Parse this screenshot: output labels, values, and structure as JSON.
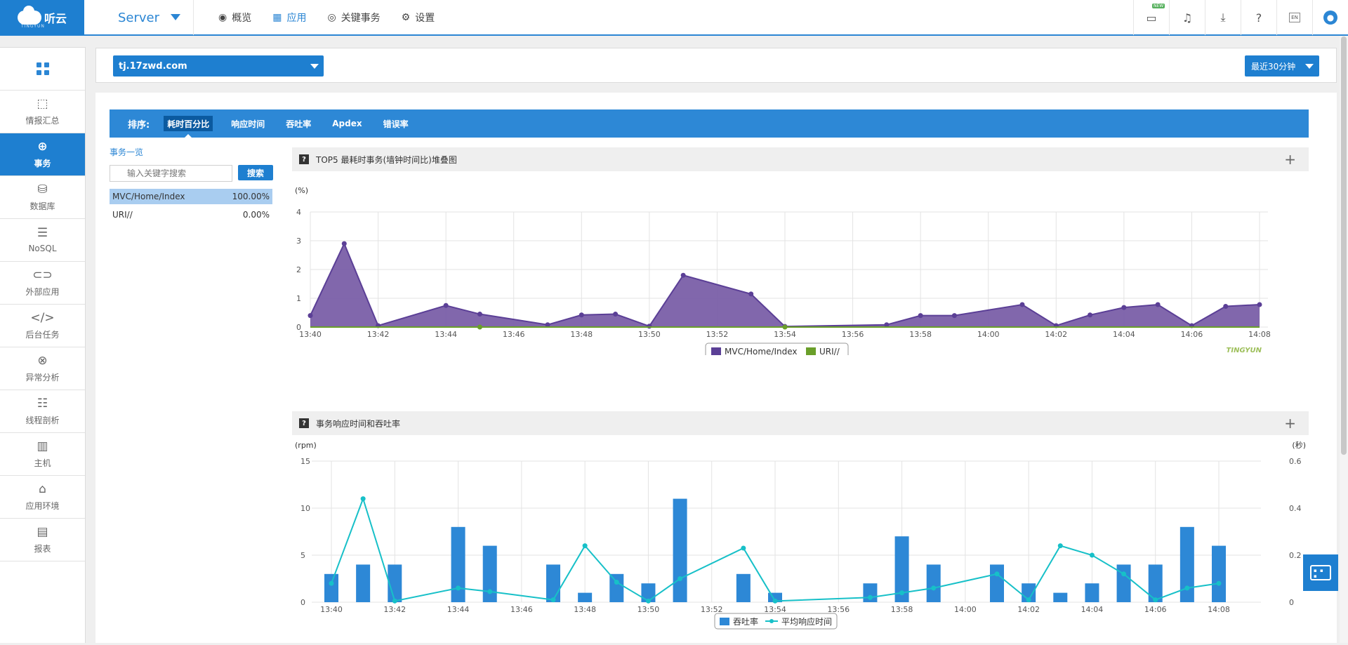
{
  "topbar": {
    "logo_text": "听云",
    "logo_sub": "TINGYUN",
    "product": "Server",
    "nav": [
      {
        "icon": "eye-icon",
        "label": "概览"
      },
      {
        "icon": "apps-grid-icon",
        "label": "应用"
      },
      {
        "icon": "target-icon",
        "label": "关键事务"
      },
      {
        "icon": "gear-icon",
        "label": "设置"
      }
    ],
    "active_nav": "应用",
    "right_icons": [
      "monitor-icon",
      "bell-icon",
      "download-icon",
      "help-icon",
      "language-icon",
      "user-icon"
    ],
    "new_badge": "NEW",
    "lang": "EN"
  },
  "sidebar": {
    "items": [
      {
        "icon": "summary-icon",
        "label": "情报汇总"
      },
      {
        "icon": "globe-icon",
        "label": "事务"
      },
      {
        "icon": "database-icon",
        "label": "数据库"
      },
      {
        "icon": "list-icon",
        "label": "NoSQL"
      },
      {
        "icon": "link-icon",
        "label": "外部应用"
      },
      {
        "icon": "code-icon",
        "label": "后台任务"
      },
      {
        "icon": "error-icon",
        "label": "异常分析"
      },
      {
        "icon": "profiler-icon",
        "label": "线程剖析"
      },
      {
        "icon": "host-icon",
        "label": "主机"
      },
      {
        "icon": "environment-icon",
        "label": "应用环境"
      },
      {
        "icon": "report-icon",
        "label": "报表"
      }
    ],
    "active": "事务"
  },
  "appbar": {
    "app_name": "tj.17zwd.com",
    "time_range": "最近30分钟"
  },
  "sortbar": {
    "label": "排序:",
    "tabs": [
      "耗时百分比",
      "响应时间",
      "吞吐率",
      "Apdex",
      "错误率"
    ],
    "active": "耗时百分比"
  },
  "txlist": {
    "title": "事务一览",
    "search_placeholder": "输入关键字搜索",
    "search_button": "搜索",
    "rows": [
      {
        "name": "MVC/Home/Index",
        "pct": "100.00%"
      },
      {
        "name": "URI//",
        "pct": "0.00%"
      }
    ]
  },
  "panel1": {
    "title": "TOP5 最耗时事务(墙钟时间比)堆叠图",
    "plus": "+",
    "watermark": "TINGYUN"
  },
  "panel2": {
    "title": "事务响应时间和吞吐率",
    "plus": "+"
  },
  "chart_data": [
    {
      "type": "area",
      "title": "TOP5 最耗时事务(墙钟时间比)堆叠图",
      "ylabel": "(%)",
      "ylim": [
        0,
        4
      ],
      "yticks": [
        0,
        1,
        2,
        3,
        4
      ],
      "x": [
        "13:40",
        "13:41",
        "13:42",
        "13:43",
        "13:44",
        "13:45",
        "13:46",
        "13:47",
        "13:48",
        "13:49",
        "13:50",
        "13:51",
        "13:52",
        "13:53",
        "13:54",
        "13:55",
        "13:56",
        "13:57",
        "13:58",
        "13:59",
        "14:00",
        "14:01",
        "14:02",
        "14:03",
        "14:04",
        "14:05",
        "14:06",
        "14:07",
        "14:08"
      ],
      "xtick_labels": [
        "13:40",
        "13:42",
        "13:44",
        "13:46",
        "13:48",
        "13:50",
        "13:52",
        "13:54",
        "13:56",
        "13:58",
        "14:00",
        "14:02",
        "14:04",
        "14:06",
        "14:08"
      ],
      "series": [
        {
          "name": "MVC/Home/Index",
          "color": "#5b3f96",
          "values": [
            0.4,
            2.9,
            0.05,
            null,
            0.75,
            0.45,
            null,
            0.08,
            0.42,
            0.45,
            0.03,
            1.8,
            null,
            1.15,
            0.02,
            null,
            null,
            0.08,
            0.4,
            0.4,
            null,
            0.78,
            0.05,
            0.42,
            0.68,
            0.78,
            0.05,
            0.72,
            0.78
          ]
        },
        {
          "name": "URI//",
          "color": "#6a9f2a",
          "values": [
            0,
            0,
            0,
            0,
            0,
            0,
            0,
            0,
            0,
            0,
            0,
            0,
            0,
            0,
            0,
            0,
            0,
            0,
            0,
            0,
            0,
            0,
            0,
            0,
            0,
            0,
            0,
            0,
            0
          ]
        }
      ],
      "legend": "bottom-center",
      "grid": true
    },
    {
      "type": "bar",
      "title": "事务响应时间和吞吐率",
      "ylabel_left": "(rpm)",
      "ylabel_right": "(秒)",
      "ylim_left": [
        0,
        15
      ],
      "ylim_right": [
        0,
        0.6
      ],
      "yticks_left": [
        0,
        5,
        10,
        15
      ],
      "yticks_right": [
        0,
        0.2,
        0.4,
        0.6
      ],
      "x": [
        "13:40",
        "13:41",
        "13:42",
        "13:43",
        "13:44",
        "13:45",
        "13:46",
        "13:47",
        "13:48",
        "13:49",
        "13:50",
        "13:51",
        "13:52",
        "13:53",
        "13:54",
        "13:55",
        "13:56",
        "13:57",
        "13:58",
        "13:59",
        "14:00",
        "14:01",
        "14:02",
        "14:03",
        "14:04",
        "14:05",
        "14:06",
        "14:07",
        "14:08"
      ],
      "xtick_labels": [
        "13:40",
        "13:42",
        "13:44",
        "13:46",
        "13:48",
        "13:50",
        "13:52",
        "13:54",
        "13:56",
        "13:58",
        "14:00",
        "14:02",
        "14:04",
        "14:06",
        "14:08"
      ],
      "series": [
        {
          "name": "吞吐率",
          "kind": "bar",
          "axis": "left",
          "color": "#2d88d6",
          "values": [
            3,
            4,
            4,
            null,
            8,
            6,
            null,
            4,
            1,
            3,
            2,
            11,
            null,
            3,
            1,
            null,
            null,
            2,
            7,
            4,
            null,
            4,
            2,
            1,
            2,
            4,
            4,
            8,
            6
          ]
        },
        {
          "name": "平均响应时间",
          "kind": "line",
          "axis": "right",
          "color": "#17c0c8",
          "values": [
            0.08,
            0.44,
            0.005,
            null,
            0.06,
            0.045,
            null,
            0.01,
            0.24,
            0.085,
            0.005,
            0.1,
            null,
            0.23,
            0.005,
            null,
            null,
            0.02,
            0.04,
            0.06,
            null,
            0.12,
            0.01,
            0.24,
            0.2,
            0.12,
            0.01,
            0.06,
            0.08
          ]
        }
      ],
      "legend": "bottom-center",
      "grid": true
    }
  ]
}
